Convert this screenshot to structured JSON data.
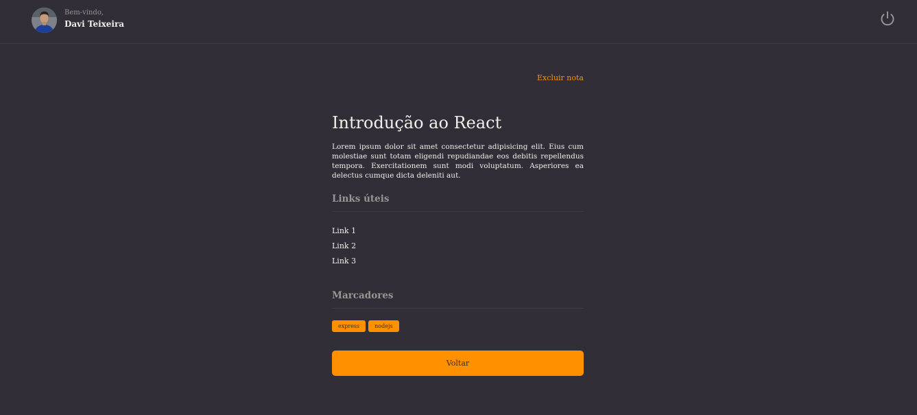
{
  "header": {
    "avatar_icon": "user-avatar-photo",
    "greeting": "Bem-vindo,",
    "user_name": "Davi Teixeira",
    "logout_icon": "power-icon"
  },
  "note": {
    "delete_label": "Excluir nota",
    "title": "Introdução ao React",
    "description": "Lorem ipsum dolor sit amet consectetur adipisicing elit. Eius cum molestiae sunt totam eligendi repudiandae eos debitis repellendus tempora. Exercitationem sunt modi voluptatum. Asperiores ea delectus cumque dicta deleniti aut.",
    "links_section_title": "Links úteis",
    "links": [
      "Link 1",
      "Link 2",
      "Link 3"
    ],
    "tags_section_title": "Marcadores",
    "tags": [
      "express",
      "nodejs"
    ],
    "back_label": "Voltar"
  },
  "colors": {
    "background": "#312e38",
    "accent": "#ff9000",
    "text": "#f4ede8",
    "muted": "#999591",
    "divider": "#3e3b47"
  }
}
